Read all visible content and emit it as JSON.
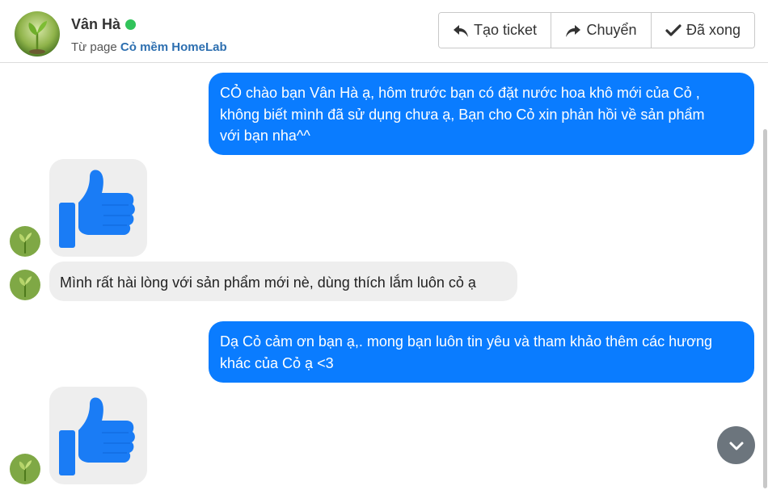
{
  "contact": {
    "name": "Vân Hà",
    "status_color": "#31c35a",
    "source_prefix": "Từ page",
    "page_name": "Cỏ mềm HomeLab"
  },
  "actions": {
    "create_ticket": "Tạo ticket",
    "forward": "Chuyển",
    "done": "Đã xong"
  },
  "messages": [
    {
      "direction": "outgoing",
      "type": "text",
      "lines": [
        "CỎ chào bạn Vân Hà ạ, hôm trước bạn có đặt nước hoa khô mới của Cỏ ,",
        "không biết mình đã sử dụng chưa ạ, Bạn cho Cỏ xin phản hồi về sản phẩm",
        "với bạn nha^^"
      ]
    },
    {
      "direction": "incoming",
      "type": "sticker",
      "sticker": "thumbs-up"
    },
    {
      "direction": "incoming",
      "type": "text",
      "lines": [
        "Mình rất hài lòng với sản phẩm mới nè, dùng thích lắm luôn cỏ ạ"
      ]
    },
    {
      "direction": "outgoing",
      "type": "text",
      "lines": [
        "Dạ Cỏ cảm ơn bạn ạ,. mong bạn luôn tin yêu và tham khảo thêm các hương",
        "khác của Cỏ ạ <3"
      ]
    },
    {
      "direction": "incoming",
      "type": "sticker",
      "sticker": "thumbs-up"
    }
  ],
  "colors": {
    "outgoing_bubble": "#0a7cff",
    "incoming_bubble": "#eeeeee",
    "thumb": "#1a7cf5",
    "scroll_button": "#6c757d"
  },
  "icons": {
    "reply": "reply-arrow-icon",
    "forward": "share-arrow-icon",
    "done": "checkmark-icon",
    "scroll": "chevron-down-icon"
  }
}
